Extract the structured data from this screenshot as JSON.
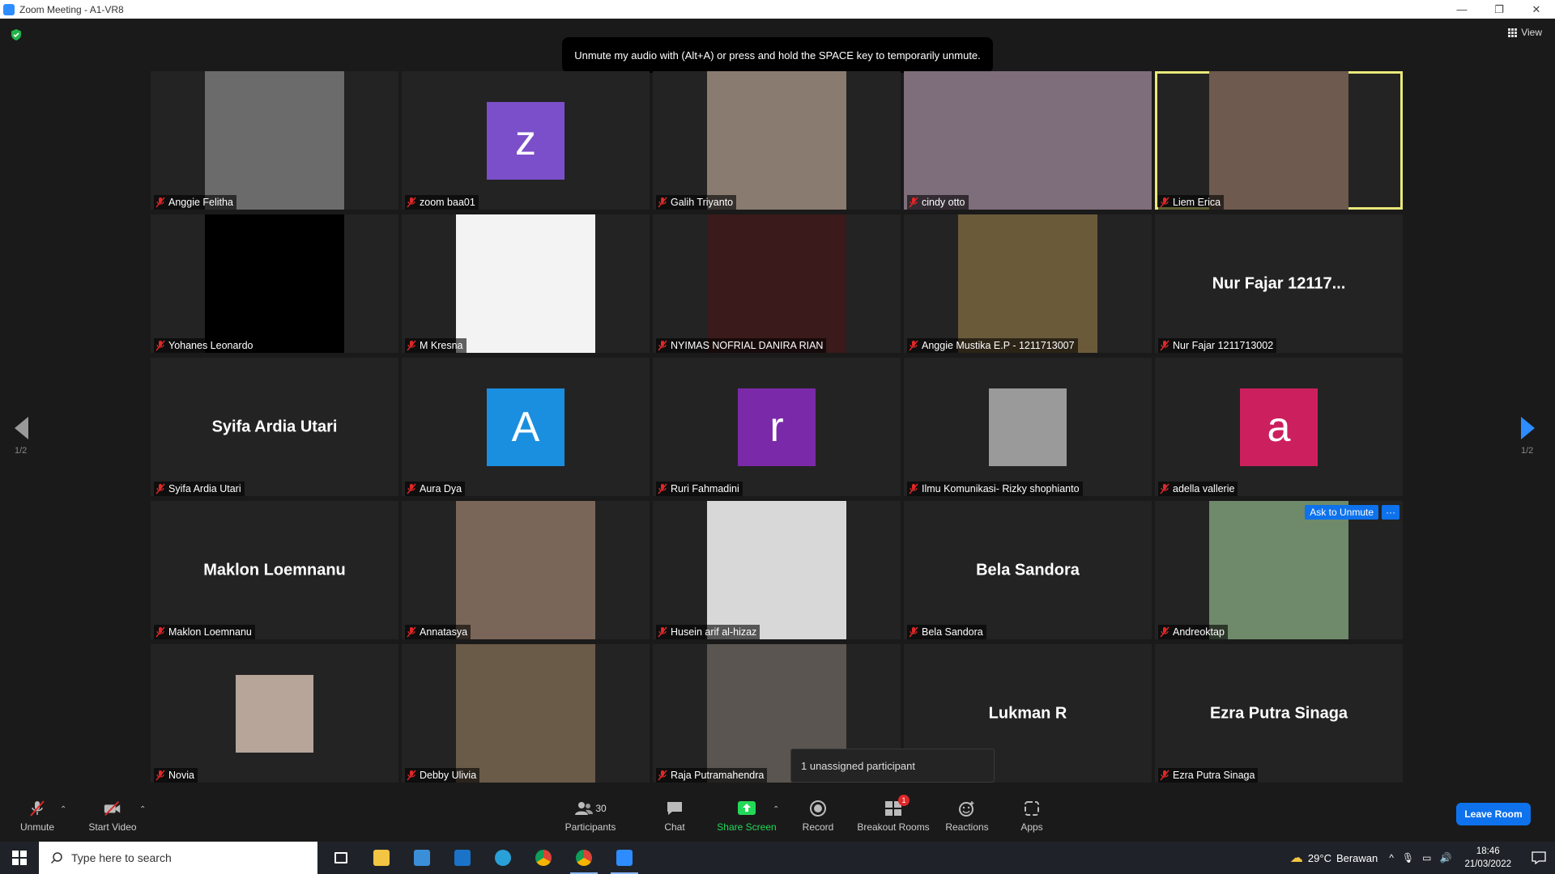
{
  "window": {
    "title": "Zoom Meeting - A1-VR8",
    "controls": [
      "—",
      "❐",
      "✕"
    ]
  },
  "top": {
    "view_label": "View",
    "tooltip": "Unmute my audio with (Alt+A) or press and hold the SPACE key to temporarily unmute."
  },
  "tiles": [
    {
      "name": "Anggie Felitha",
      "kind": "video",
      "bg": "#6b6b6b"
    },
    {
      "name": "zoom baa01",
      "kind": "avatar",
      "letter": "z",
      "color": "#7b4fc9"
    },
    {
      "name": "Galih Triyanto",
      "kind": "video",
      "bg": "#8a7b70"
    },
    {
      "name": "cindy otto",
      "kind": "video-wide",
      "bg": "#7e6d7a"
    },
    {
      "name": "Liem Erica",
      "kind": "video",
      "bg": "#6e5a4e",
      "active": true
    },
    {
      "name": "Yohanes Leonardo",
      "kind": "video",
      "bg": "#000000"
    },
    {
      "name": "M Kresna",
      "kind": "video",
      "bg": "#f3f3f3"
    },
    {
      "name": "NYIMAS NOFRIAL DANIRA RIAN",
      "kind": "video",
      "bg": "#3a1a1a"
    },
    {
      "name": "Anggie Mustika E.P - 1211713007",
      "kind": "video",
      "bg": "#6b5a3a"
    },
    {
      "name": "Nur Fajar 1211713002",
      "kind": "text",
      "big": "Nur Fajar 12117..."
    },
    {
      "name": "Syifa Ardia Utari",
      "kind": "text",
      "big": "Syifa Ardia Utari"
    },
    {
      "name": "Aura Dya",
      "kind": "avatar",
      "letter": "A",
      "color": "#1a8fe0"
    },
    {
      "name": "Ruri Fahmadini",
      "kind": "avatar",
      "letter": "r",
      "color": "#7a2aa8"
    },
    {
      "name": "Ilmu Komunikasi- Rizky shophianto",
      "kind": "photo",
      "bg": "#9a9a9a"
    },
    {
      "name": "adella vallerie",
      "kind": "avatar",
      "letter": "a",
      "color": "#cc1f5e"
    },
    {
      "name": "Maklon Loemnanu",
      "kind": "text",
      "big": "Maklon Loemnanu"
    },
    {
      "name": "Annatasya",
      "kind": "video",
      "bg": "#7a6658"
    },
    {
      "name": "Husein arif al-hizaz",
      "kind": "video",
      "bg": "#d8d8d8"
    },
    {
      "name": "Bela Sandora",
      "kind": "text",
      "big": "Bela Sandora"
    },
    {
      "name": "Andreoktap",
      "kind": "video",
      "bg": "#6f8a6a",
      "ask_unmute": "Ask to Unmute",
      "more": "···"
    },
    {
      "name": "Novia",
      "kind": "photo",
      "bg": "#b7a59a"
    },
    {
      "name": "Debby Ulivia",
      "kind": "video",
      "bg": "#6a5a48"
    },
    {
      "name": "Raja Putramahendra",
      "kind": "video",
      "bg": "#5a5550"
    },
    {
      "name": "Lukman R",
      "kind": "text",
      "big": "Lukman R",
      "no_label": true
    },
    {
      "name": "Ezra Putra Sinaga",
      "kind": "text",
      "big": "Ezra Putra Sinaga"
    }
  ],
  "pager": {
    "left": "1/2",
    "right": "1/2"
  },
  "popup": "1 unassigned participant",
  "toolbar": {
    "unmute": "Unmute",
    "start_video": "Start Video",
    "participants": "Participants",
    "participants_count": "30",
    "chat": "Chat",
    "share_screen": "Share Screen",
    "record": "Record",
    "breakout_rooms": "Breakout Rooms",
    "breakout_badge": "1",
    "reactions": "Reactions",
    "apps": "Apps",
    "leave": "Leave Room"
  },
  "taskbar": {
    "search_placeholder": "Type here to search",
    "weather_temp": "29°C",
    "weather_desc": "Berawan",
    "time": "18:46",
    "date": "21/03/2022"
  },
  "colors": {
    "accent": "#0e72ed",
    "share_green": "#23d959",
    "active_border": "#e9e87a",
    "mute_red": "#e02828"
  }
}
